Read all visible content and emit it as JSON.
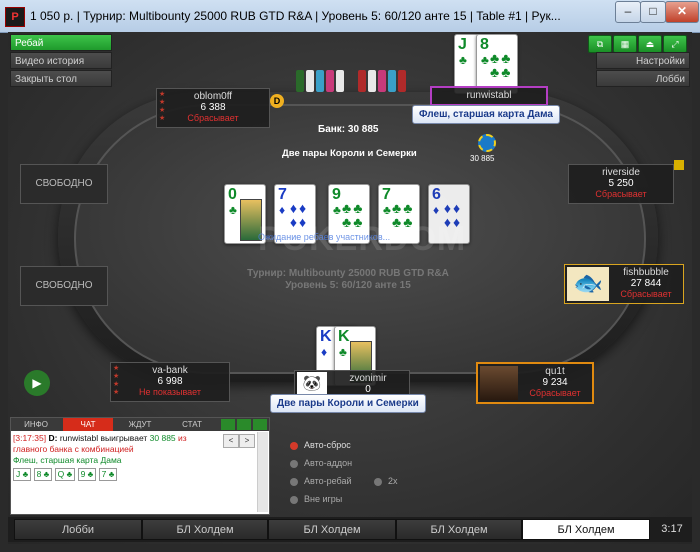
{
  "window": {
    "title": "1 050 р. | Турнир: Multibounty 25000 RUB GTD R&A | Уровень 5: 60/120 анте 15 | Table #1 | Рук...",
    "app_icon": "P"
  },
  "left_menu": {
    "rebuy": "Ребай",
    "video_history": "Видео история",
    "close_table": "Закрыть стол"
  },
  "right_menu": {
    "settings": "Настройки",
    "lobby": "Лобби"
  },
  "table": {
    "pot_label": "Банк: 30 885",
    "board_hand": "Две пары Короли и Семерки",
    "watermark": "POKERDOM",
    "join_hint": "Ожидание ребаев участников...",
    "tourney_line1": "Турнир: Multibounty 25000 RUB GTD R&A",
    "tourney_line2": "Уровень 5: 60/120 анте 15",
    "pot_chip_value": "30 885",
    "dealer_label": "D"
  },
  "board_cards": [
    {
      "rank": "0",
      "suit": "♣",
      "color": "grn"
    },
    {
      "rank": "7",
      "suit": "♦",
      "color": "blu"
    },
    {
      "rank": "9",
      "suit": "♣",
      "color": "grn"
    },
    {
      "rank": "7",
      "suit": "♣",
      "color": "grn"
    },
    {
      "rank": "6",
      "suit": "♦",
      "color": "blu"
    }
  ],
  "players": {
    "oblom0ff": {
      "name": "oblom0ff",
      "stack": "6 388",
      "status": "Сбрасывает"
    },
    "runwistabl": {
      "name": "runwistabl",
      "hand": "Флеш, старшая карта Дама",
      "card1": "J",
      "card2": "8"
    },
    "riverside": {
      "name": "riverside",
      "stack": "5 250",
      "status": "Сбрасывает"
    },
    "fishbubble": {
      "name": "fishbubble",
      "stack": "27 844",
      "status": "Сбрасывает"
    },
    "qu1t": {
      "name": "qu1t",
      "stack": "9 234",
      "status": "Сбрасывает"
    },
    "zvonimir": {
      "name": "zvonimir",
      "stack": "0",
      "hand": "Две пары Короли и Семерки",
      "card1": "K",
      "card2": "K"
    },
    "vabank": {
      "name": "va-bank",
      "stack": "6 998",
      "status": "Не показывает"
    }
  },
  "free_seat": "СВОБОДНО",
  "chat": {
    "tabs": [
      "ИНФО",
      "ЧАТ",
      "ЖДУТ",
      "СТАТ"
    ],
    "time": "[3:17:35]",
    "winner": "runwistabl",
    "wins_text": "выигрывает",
    "amount": "30 885",
    "from": "из",
    "line2": "главного банка с комбинацией",
    "line3": "Флеш, старшая карта Дама",
    "hand_cards": [
      "J ♣",
      "8 ♣",
      "Q ♣",
      "9 ♣",
      "7 ♣"
    ]
  },
  "options": {
    "auto_fold": "Авто-сброс",
    "auto_addon": "Авто-аддон",
    "auto_rebuy": "Авто-ребай",
    "x2": "2x",
    "sit_out": "Вне игры"
  },
  "bottom_tabs": [
    "Лобби",
    "БЛ Холдем",
    "БЛ Холдем",
    "БЛ Холдем",
    "БЛ Холдем"
  ],
  "clock": "3:17"
}
